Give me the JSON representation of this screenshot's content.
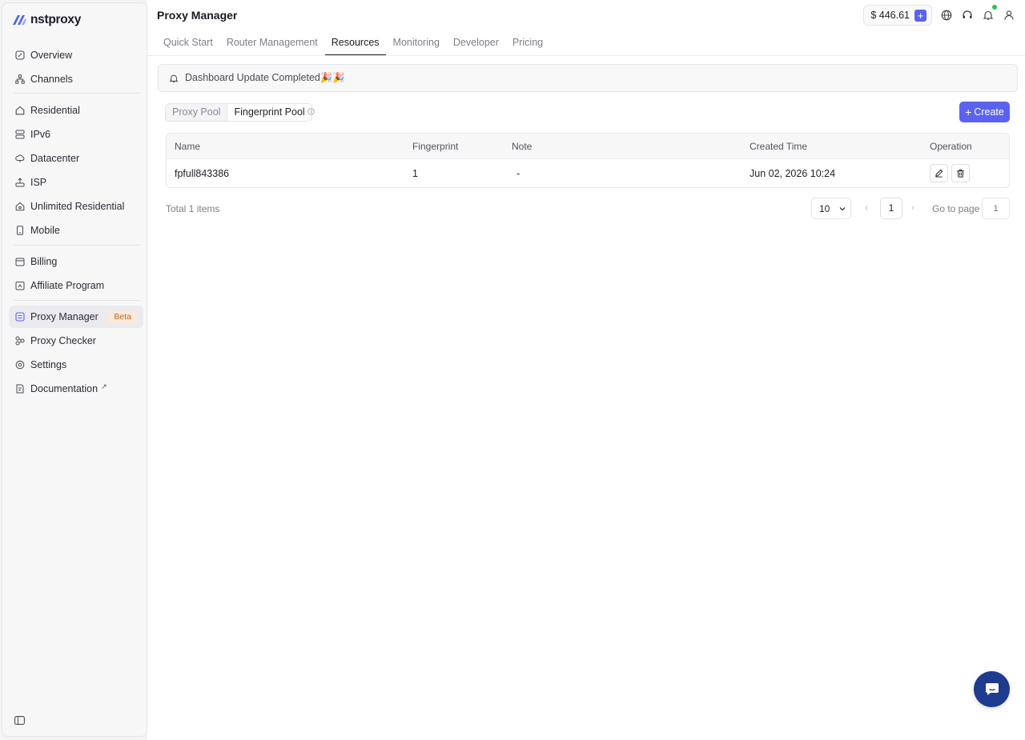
{
  "brand": {
    "name": "nstproxy"
  },
  "sidebar": {
    "items": [
      {
        "label": "Overview",
        "icon": "overview-icon"
      },
      {
        "label": "Channels",
        "icon": "channels-icon"
      },
      {
        "label": "Residential",
        "icon": "residential-icon"
      },
      {
        "label": "IPv6",
        "icon": "ipv6-icon"
      },
      {
        "label": "Datacenter",
        "icon": "datacenter-icon"
      },
      {
        "label": "ISP",
        "icon": "isp-icon"
      },
      {
        "label": "Unlimited Residential",
        "icon": "unlimited-icon"
      },
      {
        "label": "Mobile",
        "icon": "mobile-icon"
      },
      {
        "label": "Billing",
        "icon": "billing-icon"
      },
      {
        "label": "Affiliate Program",
        "icon": "affiliate-icon"
      },
      {
        "label": "Proxy Manager",
        "icon": "proxy-manager-icon",
        "badge": "Beta",
        "active": true
      },
      {
        "label": "Proxy Checker",
        "icon": "proxy-checker-icon"
      },
      {
        "label": "Settings",
        "icon": "settings-icon"
      },
      {
        "label": "Documentation",
        "icon": "documentation-icon"
      }
    ]
  },
  "header": {
    "title": "Proxy Manager",
    "balance": "$ 446.61",
    "tabs": [
      "Quick Start",
      "Router Management",
      "Resources",
      "Monitoring",
      "Developer",
      "Pricing"
    ],
    "active_tab": "Resources"
  },
  "banner": {
    "text": "Dashboard Update Completed🎉🎉"
  },
  "pools": {
    "tabs": [
      "Proxy Pool",
      "Fingerprint Pool"
    ],
    "active": "Fingerprint Pool"
  },
  "create_label": "Create",
  "table": {
    "headers": [
      "Name",
      "Fingerprint",
      "Note",
      "Created Time",
      "Operation"
    ],
    "rows": [
      {
        "name": "fpfull843386",
        "fingerprint": "1",
        "note": "-",
        "created": "Jun 02, 2026 10:24"
      }
    ]
  },
  "pagination": {
    "total": "Total 1 items",
    "page_size": "10",
    "current_page": "1",
    "goto_label": "Go to page",
    "goto_placeholder": "1"
  },
  "colors": {
    "accent": "#5b62f0",
    "chat": "#1f3b8f",
    "badge_bg": "#fbe9dc",
    "badge_fg": "#c06a25"
  }
}
